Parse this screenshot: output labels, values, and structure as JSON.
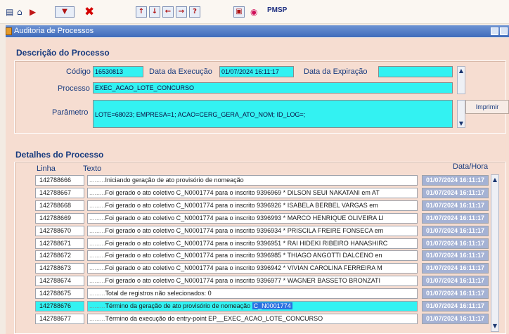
{
  "toolbar": {
    "icons": [
      "save-icon",
      "home-icon",
      "exit-icon",
      "query-icon",
      "close-icon",
      "up-icon",
      "down-icon",
      "left-icon",
      "right-icon",
      "help-icon",
      "window-icon",
      "color-icon"
    ],
    "pmsp_label": "PMSP"
  },
  "window": {
    "title": "Auditoria de Processos"
  },
  "descricao": {
    "section_title": "Descrição do Processo",
    "codigo_label": "Código",
    "codigo_value": "16530813",
    "data_execucao_label": "Data da Execução",
    "data_execucao_value": "01/07/2024 16:11:17",
    "data_expiracao_label": "Data da Expiração",
    "data_expiracao_value": "",
    "processo_label": "Processo",
    "processo_value": "EXEC_ACAO_LOTE_CONCURSO",
    "parametro_label": "Parâmetro",
    "parametro_value": "LOTE=68023; EMPRESA=1; ACAO=CERG_GERA_ATO_NOM; ID_LOG=;",
    "imprimir_label": "Imprimir"
  },
  "detalhes": {
    "section_title": "Detalhes do Processo",
    "col_linha": "Linha",
    "col_texto": "Texto",
    "col_data": "Data/Hora",
    "rows": [
      {
        "linha": "142788666",
        "texto": "Iniciando geração de ato provisório de nomeação",
        "data": "01/07/2024 16:11:17"
      },
      {
        "linha": "142788667",
        "texto": "Foi gerado o ato coletivo C_N0001774 para o inscrito 9396969 * DILSON SEUI NAKATANI em AT",
        "data": "01/07/2024 16:11:17"
      },
      {
        "linha": "142788668",
        "texto": "Foi gerado o ato coletivo C_N0001774 para o inscrito 9396926 * ISABELA BERBEL VARGAS em",
        "data": "01/07/2024 16:11:17"
      },
      {
        "linha": "142788669",
        "texto": "Foi gerado o ato coletivo C_N0001774 para o inscrito 9396993 * MARCO HENRIQUE OLIVEIRA LI",
        "data": "01/07/2024 16:11:17"
      },
      {
        "linha": "142788670",
        "texto": "Foi gerado o ato coletivo C_N0001774 para o inscrito 9396934 * PRISCILA FREIRE FONSECA em",
        "data": "01/07/2024 16:11:17"
      },
      {
        "linha": "142788671",
        "texto": "Foi gerado o ato coletivo C_N0001774 para o inscrito 9396951 * RAI HIDEKI RIBEIRO HANASHIRC",
        "data": "01/07/2024 16:11:17"
      },
      {
        "linha": "142788672",
        "texto": "Foi gerado o ato coletivo C_N0001774 para o inscrito 9396985 * THIAGO ANGOTTI DALCENO en",
        "data": "01/07/2024 16:11:17"
      },
      {
        "linha": "142788673",
        "texto": "Foi gerado o ato coletivo C_N0001774 para o inscrito 9396942 * VIVIAN CAROLINA FERREIRA M",
        "data": "01/07/2024 16:11:17"
      },
      {
        "linha": "142788674",
        "texto": "Foi gerado o ato coletivo C_N0001774 para o inscrito 9396977 * WAGNER BASSETO BRONZATI",
        "data": "01/07/2024 16:11:17"
      },
      {
        "linha": "142788675",
        "texto": "Total de registros não selecionados: 0",
        "data": "01/07/2024 16:11:17"
      },
      {
        "linha": "142788676",
        "texto": "Término da geração de ato provisório de nomeação",
        "highlight": "C_N0001774",
        "data": "01/07/2024 16:11:17"
      },
      {
        "linha": "142788677",
        "texto": "Término da execução do entry-point EP__EXEC_ACAO_LOTE_CONCURSO",
        "data": "01/07/2024 16:11:17"
      }
    ]
  },
  "colors": {
    "field": "#33f2f2",
    "panel": "#f6ddd1",
    "titlebar": "#4a77c4",
    "label": "#173a7e"
  }
}
